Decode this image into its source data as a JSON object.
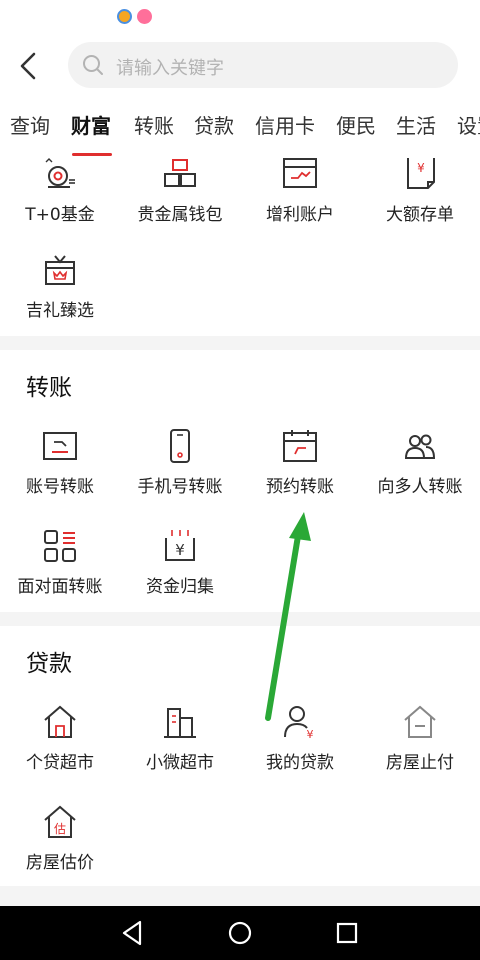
{
  "search": {
    "placeholder": "请输入关键字"
  },
  "tabs": [
    "查询",
    "财富",
    "转账",
    "贷款",
    "信用卡",
    "便民",
    "生活",
    "设置"
  ],
  "wealth": {
    "items": [
      {
        "label": "T+0基金",
        "icon": "fund-icon"
      },
      {
        "label": "贵金属钱包",
        "icon": "gold-bars-icon"
      },
      {
        "label": "增利账户",
        "icon": "chart-card-icon"
      },
      {
        "label": "大额存单",
        "icon": "deposit-receipt-icon"
      },
      {
        "label": "吉礼臻选",
        "icon": "gift-box-icon"
      }
    ]
  },
  "transfer": {
    "title": "转账",
    "items": [
      {
        "label": "账号转账",
        "icon": "card-transfer-icon"
      },
      {
        "label": "手机号转账",
        "icon": "phone-icon"
      },
      {
        "label": "预约转账",
        "icon": "calendar-icon"
      },
      {
        "label": "向多人转账",
        "icon": "people-icon"
      },
      {
        "label": "面对面转账",
        "icon": "qr-code-icon"
      },
      {
        "label": "资金归集",
        "icon": "yuan-collect-icon"
      }
    ]
  },
  "loan": {
    "title": "贷款",
    "items": [
      {
        "label": "个贷超市",
        "icon": "house-icon"
      },
      {
        "label": "小微超市",
        "icon": "buildings-icon"
      },
      {
        "label": "我的贷款",
        "icon": "user-yuan-icon"
      },
      {
        "label": "房屋止付",
        "icon": "house-stop-icon"
      },
      {
        "label": "房屋估价",
        "icon": "house-estimate-icon"
      }
    ],
    "estimate_char": "估"
  },
  "colors": {
    "accent": "#e02e2e",
    "icon_stroke": "#333333",
    "arrow": "#2aa836"
  }
}
